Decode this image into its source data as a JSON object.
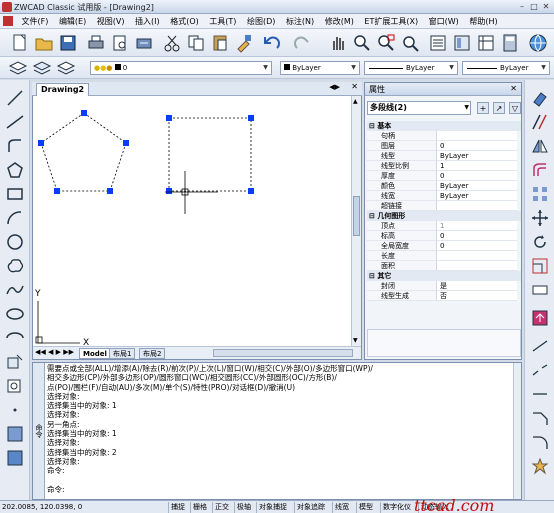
{
  "window": {
    "title": "ZWCAD Classic 试用版 - [Drawing2]"
  },
  "menu": [
    "文件(F)",
    "编辑(E)",
    "视图(V)",
    "插入(I)",
    "格式(O)",
    "工具(T)",
    "绘图(D)",
    "标注(N)",
    "修改(M)",
    "ET扩展工具(X)",
    "窗口(W)",
    "帮助(H)"
  ],
  "toolbar2": {
    "layer_value": "0",
    "color_value": "ByLayer",
    "linetype_value": "ByLayer",
    "lineweight_value": "ByLayer"
  },
  "drawing": {
    "tab": "Drawing2",
    "axis_x": "X",
    "axis_y": "Y"
  },
  "layout_tabs": [
    "Model",
    "布局1",
    "布局2"
  ],
  "properties": {
    "title": "属性",
    "selection": "多段线(2)",
    "rows": [
      {
        "k": "基本",
        "v": "",
        "cat": true
      },
      {
        "k": "句柄",
        "v": ""
      },
      {
        "k": "图层",
        "v": "0"
      },
      {
        "k": "线型",
        "v": "ByLayer"
      },
      {
        "k": "线型比例",
        "v": "1"
      },
      {
        "k": "厚度",
        "v": "0"
      },
      {
        "k": "颜色",
        "v": "ByLayer"
      },
      {
        "k": "线宽",
        "v": "ByLayer"
      },
      {
        "k": "超链接",
        "v": ""
      },
      {
        "k": "几何图形",
        "v": "",
        "cat": true
      },
      {
        "k": "顶点",
        "v": "1",
        "gray": true
      },
      {
        "k": "标高",
        "v": "0"
      },
      {
        "k": "全局宽度",
        "v": "0"
      },
      {
        "k": "长度",
        "v": ""
      },
      {
        "k": "面积",
        "v": ""
      },
      {
        "k": "其它",
        "v": "",
        "cat": true
      },
      {
        "k": "封闭",
        "v": "是"
      },
      {
        "k": "线型生成",
        "v": "否"
      }
    ]
  },
  "command": {
    "side_label": "命令",
    "lines": [
      "需要点或全部(ALL)/增添(A)/除去(R)/前次(P)/上次(L)/窗口(W)/相交(C)/外部(O)/多边形窗口(WP)/",
      "相交多边形(CP)/外部多边形(OP)/圆形窗口(WC)/相交圆形(CC)/外部圆形(OC)/方形(B)/",
      "点(PO)/围栏(F)/自动(AU)/多次(M)/单个(S)/特性(PRO)/对话框(D)/撤消(U)",
      "选择对象:",
      "选择集当中的对象: 1",
      "选择对象:",
      "另一角点:",
      "选择集当中的对象: 1",
      "选择对象:",
      "选择集当中的对象: 2",
      "选择对象:",
      "命令:",
      "",
      "命令:"
    ]
  },
  "status": {
    "coords": "202.0085,  120.0398,  0",
    "buttons": [
      "捕捉",
      "栅格",
      "正交",
      "极轴",
      "对象捕捉",
      "对象追踪",
      "线宽",
      "模型",
      "数字化仪",
      "动态输入"
    ]
  },
  "watermark": "ttcad.com",
  "colors": {
    "grip": "#0a3cff",
    "accent": "#c03030"
  }
}
